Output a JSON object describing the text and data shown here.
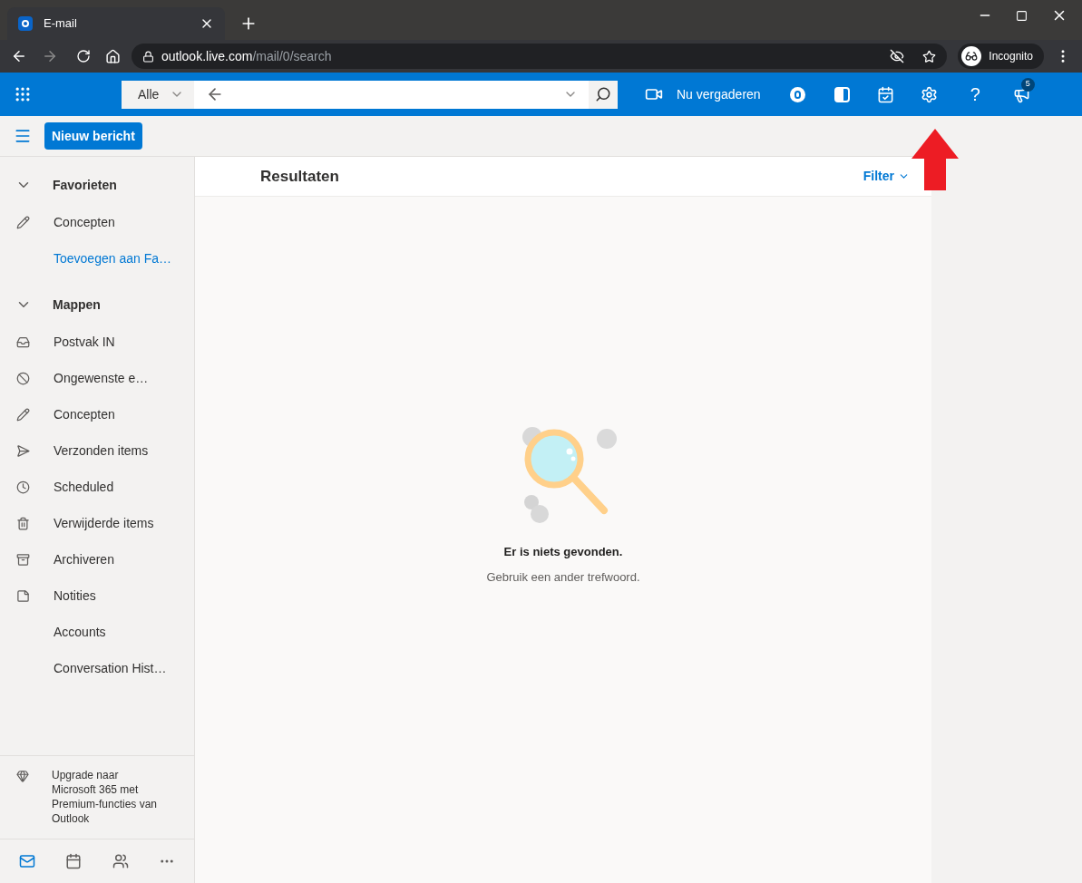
{
  "browser": {
    "tab": {
      "title": "E-mail"
    },
    "address": {
      "host": "outlook.live.com",
      "path": "/mail/0/search"
    },
    "profile": "Incognito"
  },
  "header": {
    "scope": "Alle",
    "meet": "Nu vergaderen",
    "help_glyph": "?",
    "notification_count": "5"
  },
  "compose": "Nieuw bericht",
  "sidebar": {
    "groups": [
      {
        "title": "Favorieten",
        "expanded": true,
        "items": [
          {
            "label": "Concepten",
            "kind": "folder"
          },
          {
            "label": "Toevoegen aan Fa…",
            "kind": "link"
          }
        ]
      },
      {
        "title": "Mappen",
        "expanded": true,
        "items": [
          {
            "label": "Postvak IN",
            "kind": "folder"
          },
          {
            "label": "Ongewenste e…",
            "kind": "folder"
          },
          {
            "label": "Concepten",
            "kind": "folder"
          },
          {
            "label": "Verzonden items",
            "kind": "folder"
          },
          {
            "label": "Scheduled",
            "kind": "folder"
          },
          {
            "label": "Verwijderde items",
            "kind": "folder"
          },
          {
            "label": "Archiveren",
            "kind": "folder"
          },
          {
            "label": "Notities",
            "kind": "folder"
          },
          {
            "label": "Accounts",
            "kind": "folder"
          },
          {
            "label": "Conversation Hist…",
            "kind": "folder"
          }
        ]
      }
    ],
    "upgrade": "Upgrade naar Microsoft 365 met Premium-functies van Outlook",
    "nav": [
      {
        "selected": true
      },
      {
        "selected": false
      },
      {
        "selected": false
      },
      {
        "selected": false
      }
    ]
  },
  "results": {
    "title": "Resultaten",
    "filter": "Filter",
    "empty_title": "Er is niets gevonden.",
    "empty_hint": "Gebruik een ander trefwoord."
  }
}
